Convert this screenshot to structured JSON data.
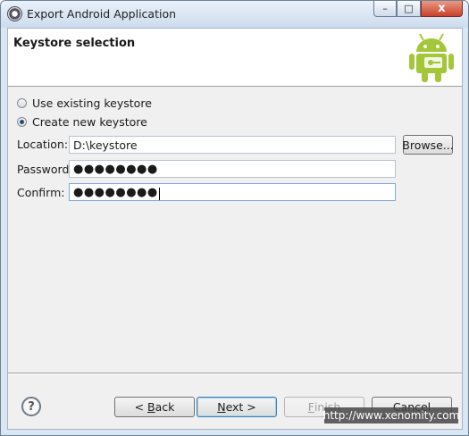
{
  "window": {
    "title": "Export Android Application",
    "minimize_label": "–",
    "maximize_label": "□",
    "close_label": "x"
  },
  "header": {
    "title": "Keystore selection"
  },
  "options": [
    {
      "label": "Use existing keystore",
      "checked": false
    },
    {
      "label": "Create new keystore",
      "checked": true
    }
  ],
  "form": {
    "location_label": "Location:",
    "location_value": "D:\\keystore",
    "browse_label": "Browse...",
    "password_label": "Password:",
    "password_value": "●●●●●●●●",
    "confirm_label": "Confirm:",
    "confirm_value": "●●●●●●●●"
  },
  "footer": {
    "help_label": "?",
    "back_prefix": "< ",
    "back_key": "B",
    "back_rest": "ack",
    "next_key": "N",
    "next_rest": "ext >",
    "finish_key": "F",
    "finish_rest": "inish",
    "cancel_label": "Cancel"
  },
  "watermark": "http://www.xenomity.com"
}
